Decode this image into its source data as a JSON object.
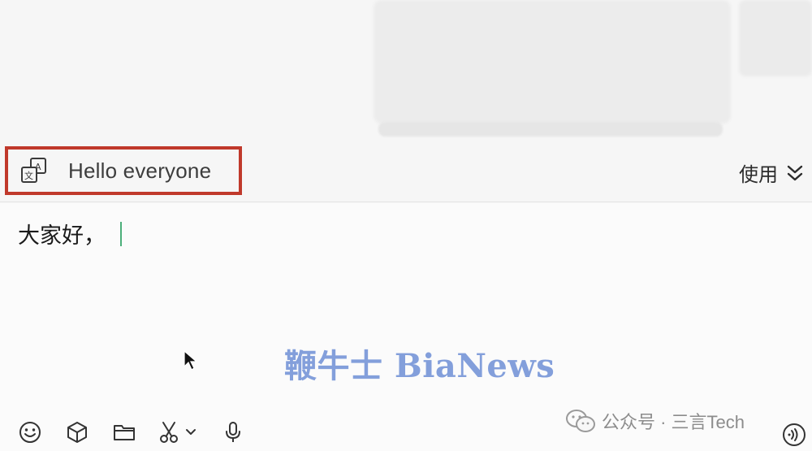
{
  "translation_bar": {
    "icon": "translate-icon",
    "text": "Hello everyone",
    "use_label": "使用",
    "expand_icon": "chevron-double-down-icon",
    "highlight_color": "#c0392b"
  },
  "input": {
    "value": "大家好，",
    "caret_color": "#4caf7a"
  },
  "watermark": {
    "text": "鞭牛士 BiaNews",
    "color": "#6f8fd6"
  },
  "toolbar": {
    "items": [
      {
        "name": "emoji",
        "icon": "smiley-icon"
      },
      {
        "name": "sticker",
        "icon": "cube-icon"
      },
      {
        "name": "file",
        "icon": "folder-icon"
      },
      {
        "name": "screenshot",
        "icon": "scissors-icon"
      },
      {
        "name": "voice",
        "icon": "microphone-icon"
      }
    ]
  },
  "source": {
    "label": "公众号 · 三言Tech"
  }
}
